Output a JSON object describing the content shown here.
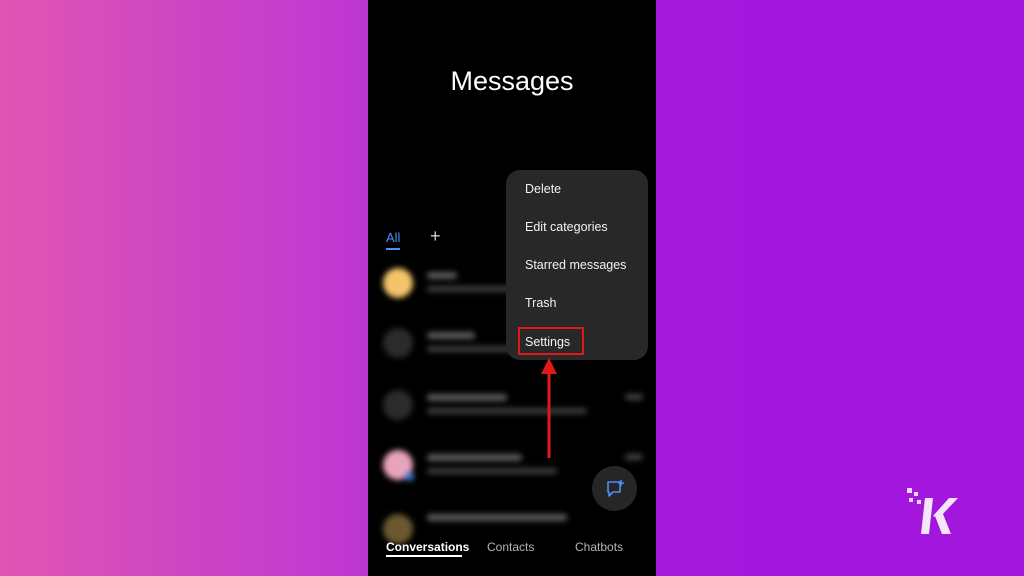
{
  "header": {
    "title": "Messages"
  },
  "category_tabs": {
    "all_label": "All",
    "add_label": "+"
  },
  "overflow_menu": {
    "items": [
      {
        "label": "Delete"
      },
      {
        "label": "Edit categories"
      },
      {
        "label": "Starred messages"
      },
      {
        "label": "Trash"
      },
      {
        "label": "Settings",
        "highlighted": true
      }
    ]
  },
  "bottom_nav": {
    "tabs": [
      {
        "label": "Conversations",
        "active": true
      },
      {
        "label": "Contacts",
        "active": false
      },
      {
        "label": "Chatbots",
        "active": false
      }
    ]
  },
  "fab": {
    "icon": "new-message-icon"
  },
  "colors": {
    "accent": "#4d8ef7",
    "highlight_red": "#e01818",
    "menu_bg": "#282828",
    "phone_bg": "#000000"
  }
}
